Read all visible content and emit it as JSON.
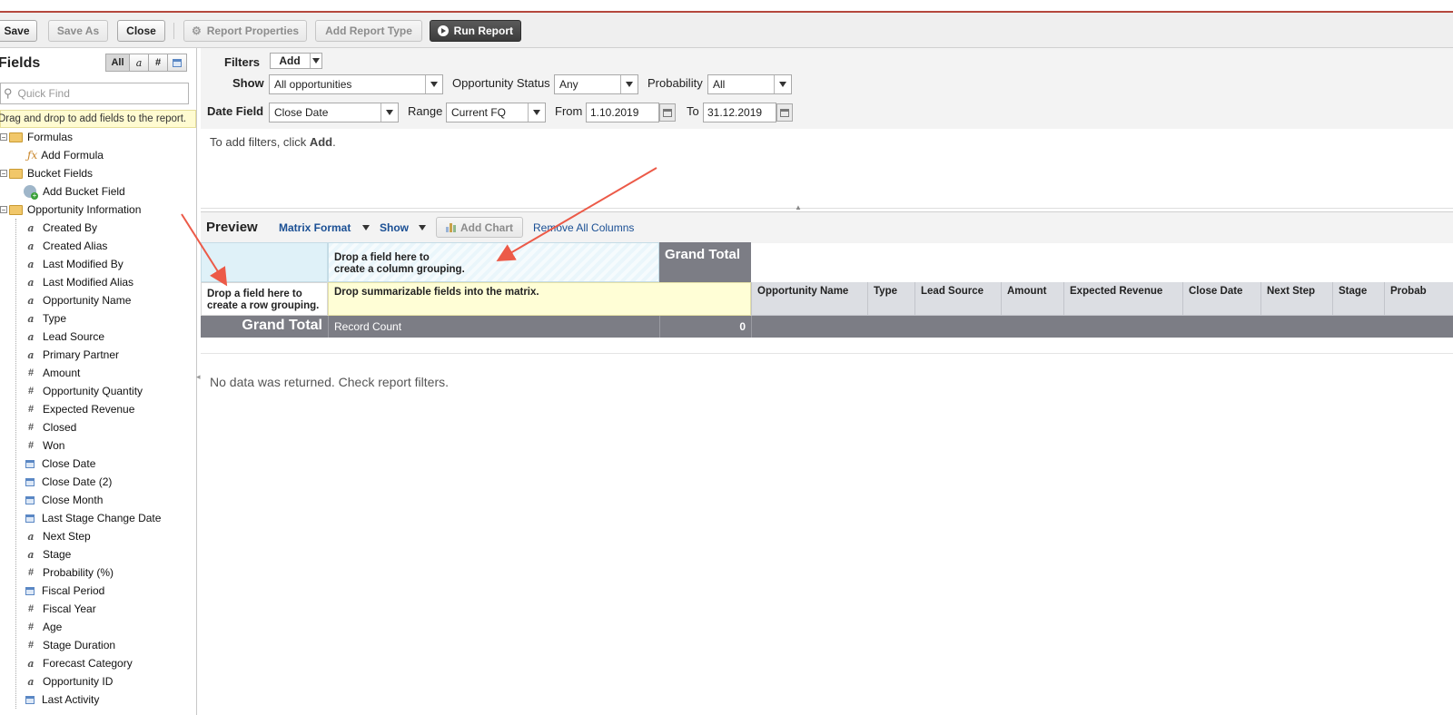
{
  "toolbar": {
    "save": "Save",
    "save_as": "Save As",
    "close": "Close",
    "report_properties": "Report Properties",
    "add_report_type": "Add Report Type",
    "run_report": "Run Report"
  },
  "sidebar": {
    "title": "Fields",
    "filter_all": "All",
    "filter_text_icon": "a",
    "filter_number_icon": "#",
    "quick_find_placeholder": "Quick Find",
    "hint": "Drag and drop to add fields to the report.",
    "formulas": "Formulas",
    "add_formula": "Add Formula",
    "bucket_fields": "Bucket Fields",
    "add_bucket_field": "Add Bucket Field",
    "opportunity_information": "Opportunity Information",
    "fields": [
      {
        "label": "Created By",
        "type": "text"
      },
      {
        "label": "Created Alias",
        "type": "text"
      },
      {
        "label": "Last Modified By",
        "type": "text"
      },
      {
        "label": "Last Modified Alias",
        "type": "text"
      },
      {
        "label": "Opportunity Name",
        "type": "text"
      },
      {
        "label": "Type",
        "type": "text"
      },
      {
        "label": "Lead Source",
        "type": "text"
      },
      {
        "label": "Primary Partner",
        "type": "text"
      },
      {
        "label": "Amount",
        "type": "number"
      },
      {
        "label": "Opportunity Quantity",
        "type": "number"
      },
      {
        "label": "Expected Revenue",
        "type": "number"
      },
      {
        "label": "Closed",
        "type": "number"
      },
      {
        "label": "Won",
        "type": "number"
      },
      {
        "label": "Close Date",
        "type": "date"
      },
      {
        "label": "Close Date (2)",
        "type": "date"
      },
      {
        "label": "Close Month",
        "type": "date"
      },
      {
        "label": "Last Stage Change Date",
        "type": "date"
      },
      {
        "label": "Next Step",
        "type": "text"
      },
      {
        "label": "Stage",
        "type": "text"
      },
      {
        "label": "Probability (%)",
        "type": "number"
      },
      {
        "label": "Fiscal Period",
        "type": "date"
      },
      {
        "label": "Fiscal Year",
        "type": "number"
      },
      {
        "label": "Age",
        "type": "number"
      },
      {
        "label": "Stage Duration",
        "type": "number"
      },
      {
        "label": "Forecast Category",
        "type": "text"
      },
      {
        "label": "Opportunity ID",
        "type": "text"
      },
      {
        "label": "Last Activity",
        "type": "date"
      }
    ]
  },
  "filters": {
    "label": "Filters",
    "add": "Add",
    "show_label": "Show",
    "show_value": "All opportunities",
    "status_label": "Opportunity Status",
    "status_value": "Any",
    "probability_label": "Probability",
    "probability_value": "All",
    "date_field_label": "Date Field",
    "date_field_value": "Close Date",
    "range_label": "Range",
    "range_value": "Current FQ",
    "from_label": "From",
    "from_value": "1.10.2019",
    "to_label": "To",
    "to_value": "31.12.2019",
    "help_prefix": "To add filters, click ",
    "help_bold": "Add",
    "help_suffix": "."
  },
  "preview": {
    "title": "Preview",
    "format": "Matrix Format",
    "show": "Show",
    "add_chart": "Add Chart",
    "remove_all": "Remove All Columns",
    "col_group_line1": "Drop a field here to",
    "col_group_line2": "create a column grouping.",
    "grand_total": "Grand Total",
    "row_group_line1": "Drop a field here to",
    "row_group_line2": "create a row grouping.",
    "summarizable": "Drop summarizable fields into the matrix.",
    "columns": [
      "Opportunity Name",
      "Type",
      "Lead Source",
      "Amount",
      "Expected Revenue",
      "Close Date",
      "Next Step",
      "Stage",
      "Probab"
    ],
    "grand_total_row": "Grand Total",
    "record_count": "Record Count",
    "record_count_value": "0",
    "no_data": "No data was returned. Check report filters."
  }
}
